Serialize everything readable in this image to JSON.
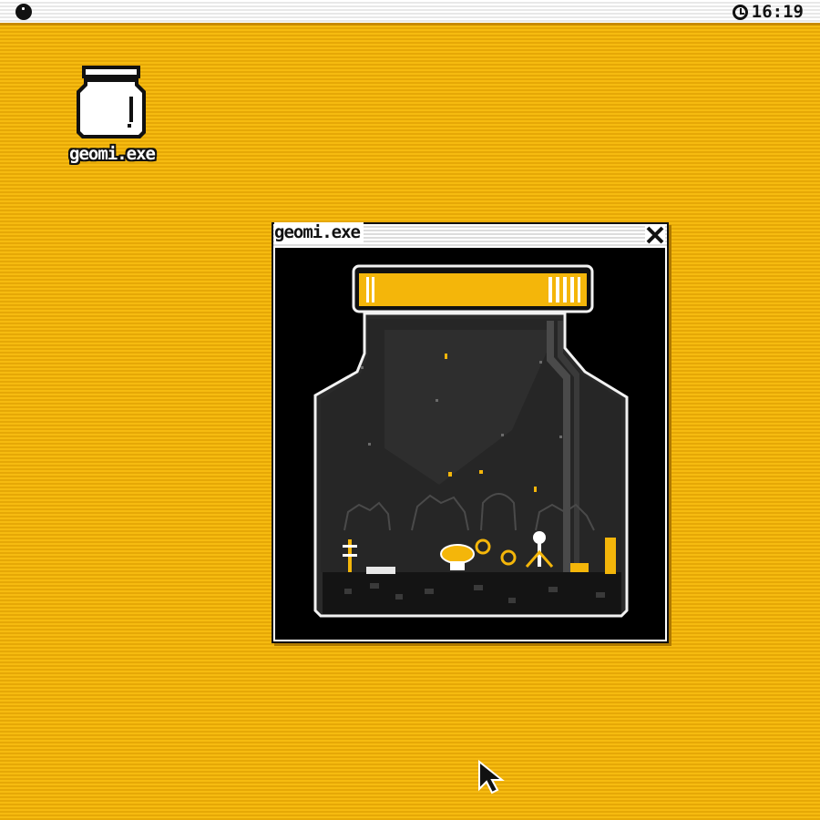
{
  "menubar": {
    "clock": "16:19",
    "clock_icon": "clock-icon",
    "menu_icon": "apple-dot-icon"
  },
  "desktop": {
    "background_color": "#f4b60a",
    "icon": {
      "label": "geomi.exe",
      "icon": "jar-icon"
    }
  },
  "window": {
    "title": "geomi.exe",
    "close_icon": "close-icon",
    "content": "terrarium-jar-scene",
    "accent_color": "#f4b60a"
  }
}
